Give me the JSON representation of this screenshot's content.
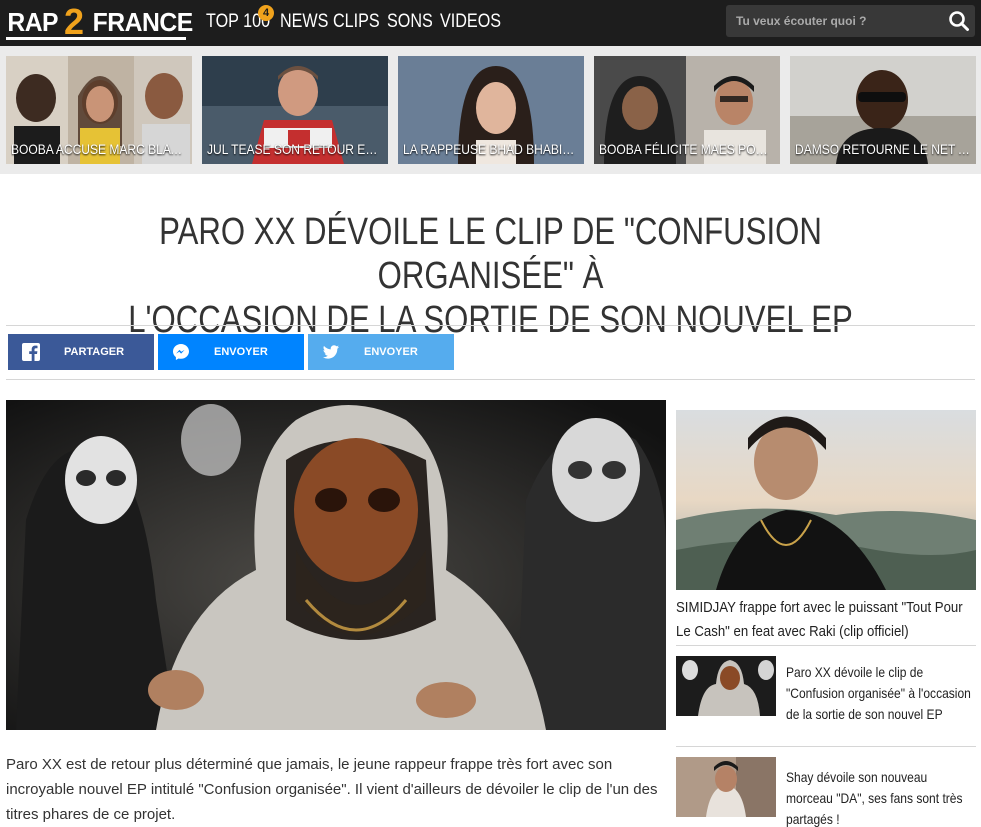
{
  "header": {
    "logo": {
      "part1": "RAP",
      "part2": "2",
      "part3": "FRANCE"
    },
    "nav": [
      {
        "label": "TOP 100",
        "badge": "4"
      },
      {
        "label": "NEWS"
      },
      {
        "label": "CLIPS"
      },
      {
        "label": "SONS"
      },
      {
        "label": "VIDEOS"
      }
    ],
    "search": {
      "placeholder": "Tu veux écouter quoi ?",
      "icon": "search-icon"
    }
  },
  "trending": [
    {
      "caption": "BOOBA ACCUSE MARC BLATA DE..."
    },
    {
      "caption": "JUL TEASE SON RETOUR ET BIENTÔT"
    },
    {
      "caption": "LA RAPPEUSE BHAD BHABIE A..."
    },
    {
      "caption": "BOOBA FÉLICITE MAES POUR SON"
    },
    {
      "caption": "DAMSO RETOURNE LE NET AVEC"
    }
  ],
  "article": {
    "title_line1": "PARO XX DÉVOILE LE CLIP DE \"CONFUSION ORGANISÉE\" À",
    "title_line2": "L'OCCASION DE LA SORTIE DE SON NOUVEL EP",
    "share": [
      {
        "label": "PARTAGER",
        "icon": "facebook-icon",
        "color": "#3b5998"
      },
      {
        "label": "ENVOYER",
        "icon": "messenger-icon",
        "color": "#0084ff"
      },
      {
        "label": "ENVOYER",
        "icon": "twitter-icon",
        "color": "#55acee"
      }
    ],
    "body": "Paro XX est de retour plus déterminé que jamais, le jeune rappeur frappe très fort avec son incroyable nouvel EP intitulé \"Confusion organisée\". Il vient d'ailleurs de dévoiler le clip de l'un des titres phares de ce projet."
  },
  "sidebar": {
    "featured": {
      "title": "SIMIDJAY frappe fort avec le puissant \"Tout Pour Le Cash\" en feat avec Raki (clip officiel)"
    },
    "items": [
      {
        "title": "Paro XX dévoile le clip de \"Confusion organisée\" à l'occasion de la sortie de son nouvel EP"
      },
      {
        "title": "Shay dévoile son nouveau morceau \"DA\", ses fans sont très partagés !"
      }
    ]
  },
  "colors": {
    "nav_bg": "#1d1d1d",
    "accent": "#f0a21c",
    "strip_bg": "#ebebeb"
  }
}
